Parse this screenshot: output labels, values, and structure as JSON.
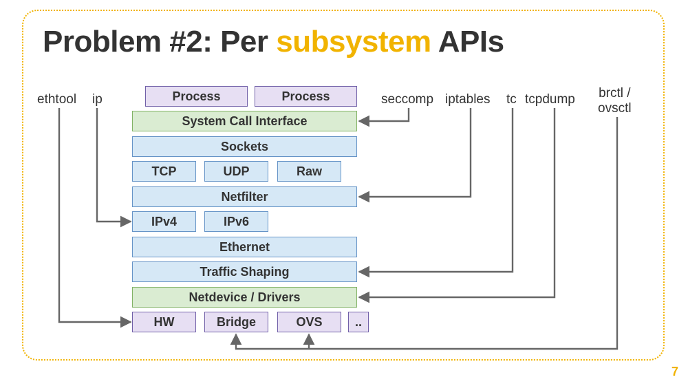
{
  "title": {
    "prefix": "Problem #2: Per ",
    "accent": "subsystem",
    "suffix": " APIs"
  },
  "page_number": "7",
  "labels": {
    "ethtool": "ethtool",
    "ip": "ip",
    "seccomp": "seccomp",
    "iptables": "iptables",
    "tc": "tc",
    "tcpdump": "tcpdump",
    "brctl": "brctl /\novsctl"
  },
  "boxes": {
    "process1": "Process",
    "process2": "Process",
    "sci": "System Call Interface",
    "sockets": "Sockets",
    "tcp": "TCP",
    "udp": "UDP",
    "raw": "Raw",
    "netfilter": "Netfilter",
    "ipv4": "IPv4",
    "ipv6": "IPv6",
    "ethernet": "Ethernet",
    "traffic": "Traffic Shaping",
    "netdevice": "Netdevice / Drivers",
    "hw": "HW",
    "bridge": "Bridge",
    "ovs": "OVS",
    "more": ".."
  }
}
